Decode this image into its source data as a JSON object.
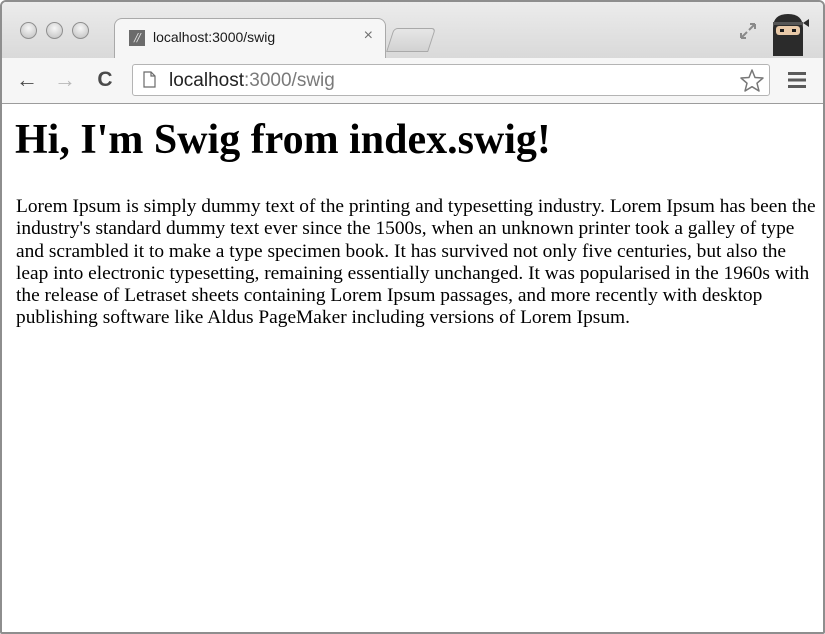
{
  "browser": {
    "tab": {
      "favicon": "//",
      "title": "localhost:3000/swig",
      "close_label": "×"
    },
    "toolbar": {
      "back_label": "←",
      "forward_label": "→",
      "reload_label": "C",
      "url_host": "localhost",
      "url_rest": ":3000/swig"
    },
    "icons": {
      "traffic_lights": [
        "close-icon",
        "minimize-icon",
        "zoom-icon"
      ],
      "new_tab": "new-tab-icon",
      "fullscreen": "resize-icon",
      "profile": "ninja-avatar-icon",
      "page": "page-icon",
      "bookmark": "star-icon",
      "menu": "hamburger-menu-icon"
    }
  },
  "page": {
    "heading": "Hi, I'm Swig from index.swig!",
    "paragraph": "Lorem Ipsum is simply dummy text of the printing and typesetting industry. Lorem Ipsum has been the industry's standard dummy text ever since the 1500s, when an unknown printer took a galley of type and scrambled it to make a type specimen book. It has survived not only five centuries, but also the leap into electronic typesetting, remaining essentially unchanged. It was popularised in the 1960s with the release of Letraset sheets containing Lorem Ipsum passages, and more recently with desktop publishing software like Aldus PageMaker including versions of Lorem Ipsum."
  }
}
